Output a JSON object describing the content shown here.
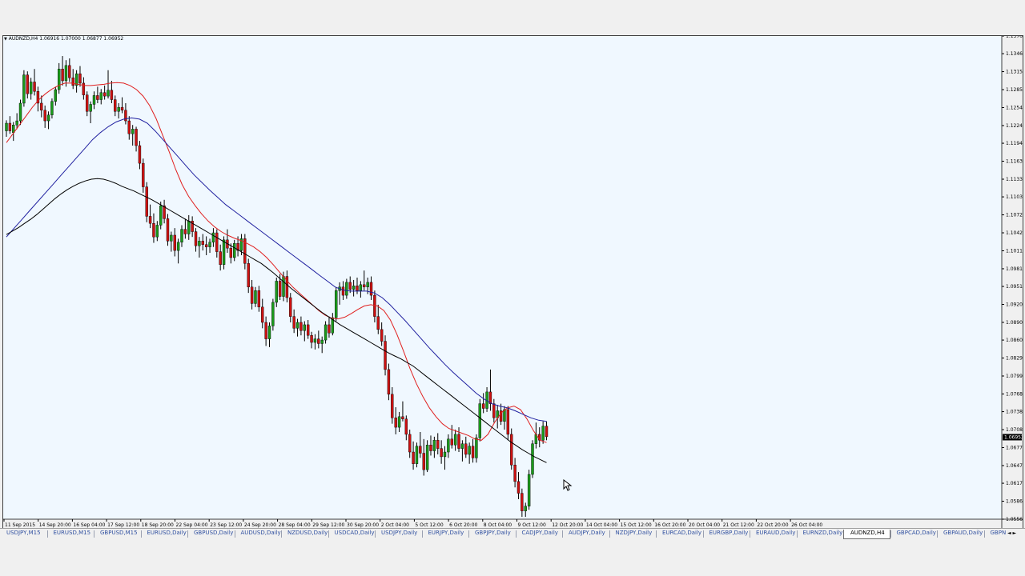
{
  "chart_header": {
    "symbol_line": "AUDNZD,H4  1.06916 1.07000 1.06877 1.06952"
  },
  "colors": {
    "background": "#f0f8ff",
    "bull": "#1a9a1a",
    "bear": "#cc1111",
    "ma_fast": "#e02020",
    "ma_mid": "#2020a0",
    "ma_slow": "#000000",
    "price_tag": "#000000"
  },
  "price_axis": {
    "labels": [
      "1.13760",
      "1.13460",
      "1.13155",
      "1.12850",
      "1.12545",
      "1.12240",
      "1.11940",
      "1.11635",
      "1.11330",
      "1.11030",
      "1.10725",
      "1.10420",
      "1.10115",
      "1.09810",
      "1.09510",
      "1.09205",
      "1.08900",
      "1.08600",
      "1.08295",
      "1.07990",
      "1.07685",
      "1.07385",
      "1.07080",
      "1.06775",
      "1.06470",
      "1.06170",
      "1.05865",
      "1.05560"
    ],
    "current_price": "1.06952"
  },
  "time_axis": {
    "labels": [
      "11 Sep 2015",
      "14 Sep 20:00",
      "16 Sep 04:00",
      "17 Sep 12:00",
      "18 Sep 20:00",
      "22 Sep 04:00",
      "23 Sep 12:00",
      "24 Sep 20:00",
      "28 Sep 04:00",
      "29 Sep 12:00",
      "30 Sep 20:00",
      "2 Oct 04:00",
      "5 Oct 12:00",
      "6 Oct 20:00",
      "8 Oct 04:00",
      "9 Oct 12:00",
      "12 Oct 20:00",
      "14 Oct 04:00",
      "15 Oct 12:00",
      "16 Oct 20:00",
      "20 Oct 04:00",
      "21 Oct 12:00",
      "22 Oct 20:00",
      "26 Oct 04:00"
    ]
  },
  "tabs": [
    {
      "label": "USDJPY,M15",
      "active": false
    },
    {
      "label": "EURUSD,M15",
      "active": false
    },
    {
      "label": "GBPUSD,M15",
      "active": false
    },
    {
      "label": "EURUSD,Daily",
      "active": false
    },
    {
      "label": "GBPUSD,Daily",
      "active": false
    },
    {
      "label": "AUDUSD,Daily",
      "active": false
    },
    {
      "label": "NZDUSD,Daily",
      "active": false
    },
    {
      "label": "USDCAD,Daily",
      "active": false
    },
    {
      "label": "USDJPY,Daily",
      "active": false
    },
    {
      "label": "EURJPY,Daily",
      "active": false
    },
    {
      "label": "GBPJPY,Daily",
      "active": false
    },
    {
      "label": "CADJPY,Daily",
      "active": false
    },
    {
      "label": "AUDJPY,Daily",
      "active": false
    },
    {
      "label": "NZDJPY,Daily",
      "active": false
    },
    {
      "label": "EURCAD,Daily",
      "active": false
    },
    {
      "label": "EURGBP,Daily",
      "active": false
    },
    {
      "label": "EURAUD,Daily",
      "active": false
    },
    {
      "label": "EURNZD,Daily",
      "active": false
    },
    {
      "label": "AUDNZD,H4",
      "active": true
    },
    {
      "label": "GBPCAD,Daily",
      "active": false
    },
    {
      "label": "GBPAUD,Daily",
      "active": false
    },
    {
      "label": "GBPN",
      "active": false
    }
  ],
  "tab_scroll": "◄ ►",
  "chart_data": {
    "type": "candlestick",
    "symbol": "AUDNZD",
    "timeframe": "H4",
    "ylim": [
      1.0556,
      1.1376
    ],
    "candles": [
      [
        1.1215,
        1.1233,
        1.1205,
        1.1228
      ],
      [
        1.1228,
        1.124,
        1.121,
        1.1215
      ],
      [
        1.1212,
        1.123,
        1.1198,
        1.1225
      ],
      [
        1.1225,
        1.1245,
        1.1218,
        1.1232
      ],
      [
        1.1232,
        1.1268,
        1.1225,
        1.1262
      ],
      [
        1.1262,
        1.1318,
        1.1256,
        1.131
      ],
      [
        1.131,
        1.1316,
        1.127,
        1.1278
      ],
      [
        1.1278,
        1.1305,
        1.1268,
        1.1298
      ],
      [
        1.1298,
        1.132,
        1.1275,
        1.1282
      ],
      [
        1.1282,
        1.129,
        1.1248,
        1.1262
      ],
      [
        1.1262,
        1.1275,
        1.1238,
        1.125
      ],
      [
        1.125,
        1.1258,
        1.122,
        1.1232
      ],
      [
        1.1232,
        1.1248,
        1.1218,
        1.1242
      ],
      [
        1.1242,
        1.127,
        1.1236,
        1.1265
      ],
      [
        1.1265,
        1.129,
        1.1258,
        1.1285
      ],
      [
        1.1285,
        1.133,
        1.1278,
        1.132
      ],
      [
        1.132,
        1.1342,
        1.1292,
        1.13
      ],
      [
        1.13,
        1.1335,
        1.129,
        1.1326
      ],
      [
        1.1326,
        1.1338,
        1.1298,
        1.1305
      ],
      [
        1.1305,
        1.132,
        1.1286,
        1.1292
      ],
      [
        1.1292,
        1.1318,
        1.128,
        1.1312
      ],
      [
        1.1312,
        1.1325,
        1.129,
        1.1296
      ],
      [
        1.1296,
        1.1306,
        1.1268,
        1.1276
      ],
      [
        1.1276,
        1.1282,
        1.124,
        1.1248
      ],
      [
        1.1248,
        1.1265,
        1.1228,
        1.126
      ],
      [
        1.126,
        1.1282,
        1.1252,
        1.1275
      ],
      [
        1.1275,
        1.129,
        1.1262,
        1.1268
      ],
      [
        1.1268,
        1.1286,
        1.126,
        1.128
      ],
      [
        1.128,
        1.1292,
        1.1268,
        1.1274
      ],
      [
        1.1274,
        1.1318,
        1.127,
        1.1284
      ],
      [
        1.1284,
        1.13,
        1.1262,
        1.1268
      ],
      [
        1.1268,
        1.1275,
        1.124,
        1.1248
      ],
      [
        1.1248,
        1.1262,
        1.1236,
        1.1255
      ],
      [
        1.1255,
        1.1272,
        1.1245,
        1.125
      ],
      [
        1.125,
        1.1262,
        1.1226,
        1.1232
      ],
      [
        1.1232,
        1.124,
        1.12,
        1.121
      ],
      [
        1.121,
        1.1225,
        1.119,
        1.1218
      ],
      [
        1.1218,
        1.1222,
        1.118,
        1.119
      ],
      [
        1.119,
        1.1198,
        1.115,
        1.116
      ],
      [
        1.116,
        1.1168,
        1.111,
        1.112
      ],
      [
        1.112,
        1.1128,
        1.106,
        1.107
      ],
      [
        1.107,
        1.109,
        1.105,
        1.1058
      ],
      [
        1.1058,
        1.1075,
        1.1025,
        1.1035
      ],
      [
        1.1035,
        1.1062,
        1.1028,
        1.1055
      ],
      [
        1.1055,
        1.1095,
        1.1048,
        1.1088
      ],
      [
        1.1088,
        1.1098,
        1.1058,
        1.1066
      ],
      [
        1.1066,
        1.1074,
        1.102,
        1.1028
      ],
      [
        1.1028,
        1.1044,
        1.101,
        1.1038
      ],
      [
        1.1038,
        1.105,
        1.1002,
        1.1012
      ],
      [
        1.1012,
        1.1032,
        1.099,
        1.1026
      ],
      [
        1.1026,
        1.1055,
        1.1018,
        1.1048
      ],
      [
        1.1048,
        1.1066,
        1.1032,
        1.104
      ],
      [
        1.104,
        1.1072,
        1.103,
        1.1062
      ],
      [
        1.1062,
        1.107,
        1.1035,
        1.1044
      ],
      [
        1.1044,
        1.105,
        1.101,
        1.102
      ],
      [
        1.102,
        1.1035,
        1.1,
        1.1028
      ],
      [
        1.1028,
        1.104,
        1.1012,
        1.1022
      ],
      [
        1.1022,
        1.1036,
        1.1004,
        1.1018
      ],
      [
        1.1018,
        1.1032,
        1.1008,
        1.1026
      ],
      [
        1.1026,
        1.105,
        1.1018,
        1.1042
      ],
      [
        1.1042,
        1.1048,
        1.1,
        1.101
      ],
      [
        1.101,
        1.1022,
        1.0978,
        1.0988
      ],
      [
        1.0988,
        1.1036,
        1.098,
        1.103
      ],
      [
        1.103,
        1.1048,
        1.1008,
        1.1016
      ],
      [
        1.1016,
        1.1024,
        1.099,
        1.1
      ],
      [
        1.1,
        1.103,
        1.0994,
        1.1024
      ],
      [
        1.1024,
        1.1036,
        1.1002,
        1.1012
      ],
      [
        1.1012,
        1.104,
        1.1004,
        1.1032
      ],
      [
        1.1032,
        1.104,
        1.098,
        1.099
      ],
      [
        1.099,
        1.0998,
        1.094,
        1.095
      ],
      [
        1.095,
        1.0962,
        1.0912,
        1.0922
      ],
      [
        1.0922,
        1.095,
        1.0916,
        1.0944
      ],
      [
        1.0944,
        1.0952,
        1.0908,
        1.0916
      ],
      [
        1.0916,
        1.093,
        1.088,
        1.089
      ],
      [
        1.089,
        1.09,
        1.085,
        1.0862
      ],
      [
        1.0862,
        1.089,
        1.0848,
        1.0884
      ],
      [
        1.0884,
        1.093,
        1.0876,
        1.0924
      ],
      [
        1.0924,
        1.0966,
        1.0916,
        1.096
      ],
      [
        1.096,
        1.0972,
        1.0928,
        1.0934
      ],
      [
        1.0934,
        1.0976,
        1.0926,
        1.0968
      ],
      [
        1.0968,
        1.0978,
        1.0924,
        1.0932
      ],
      [
        1.0932,
        1.094,
        1.089,
        1.09
      ],
      [
        1.09,
        1.0912,
        1.0872,
        1.088
      ],
      [
        1.088,
        1.0896,
        1.0866,
        1.089
      ],
      [
        1.089,
        1.09,
        1.0868,
        1.0876
      ],
      [
        1.0876,
        1.0892,
        1.0858,
        1.0886
      ],
      [
        1.0886,
        1.0894,
        1.0862,
        1.0868
      ],
      [
        1.0868,
        1.0874,
        1.0846,
        1.0856
      ],
      [
        1.0856,
        1.087,
        1.0844,
        1.0862
      ],
      [
        1.0862,
        1.0876,
        1.0846,
        1.0854
      ],
      [
        1.0854,
        1.0866,
        1.0838,
        1.086
      ],
      [
        1.086,
        1.0892,
        1.0854,
        1.0886
      ],
      [
        1.0886,
        1.09,
        1.0864,
        1.0872
      ],
      [
        1.0872,
        1.0906,
        1.0868,
        1.0898
      ],
      [
        1.0898,
        1.095,
        1.0892,
        1.0944
      ],
      [
        1.0944,
        1.0958,
        1.092,
        1.095
      ],
      [
        1.095,
        1.096,
        1.0928,
        1.0936
      ],
      [
        1.0936,
        1.0964,
        1.093,
        1.0958
      ],
      [
        1.0958,
        1.0968,
        1.094,
        1.0946
      ],
      [
        1.0946,
        1.0962,
        1.0934,
        1.0952
      ],
      [
        1.0952,
        1.0966,
        1.0938,
        1.0944
      ],
      [
        1.0944,
        1.096,
        1.0932,
        1.0954
      ],
      [
        1.0954,
        1.0978,
        1.0944,
        1.095
      ],
      [
        1.095,
        1.0966,
        1.0938,
        1.0958
      ],
      [
        1.0958,
        1.0968,
        1.0928,
        1.0936
      ],
      [
        1.0936,
        1.0944,
        1.089,
        1.09
      ],
      [
        1.09,
        1.092,
        1.087,
        1.0878
      ],
      [
        1.0878,
        1.089,
        1.085,
        1.0858
      ],
      [
        1.0858,
        1.0868,
        1.08,
        1.081
      ],
      [
        1.081,
        1.082,
        1.0758,
        1.0768
      ],
      [
        1.0768,
        1.078,
        1.0718,
        1.0728
      ],
      [
        1.0728,
        1.0746,
        1.07,
        1.0712
      ],
      [
        1.0712,
        1.0738,
        1.0704,
        1.073
      ],
      [
        1.073,
        1.0756,
        1.0722,
        1.0726
      ],
      [
        1.0726,
        1.0732,
        1.069,
        1.07
      ],
      [
        1.07,
        1.0708,
        1.066,
        1.067
      ],
      [
        1.067,
        1.0688,
        1.064,
        1.065
      ],
      [
        1.065,
        1.0686,
        1.0644,
        1.068
      ],
      [
        1.068,
        1.0704,
        1.066,
        1.0668
      ],
      [
        1.0668,
        1.0692,
        1.063,
        1.064
      ],
      [
        1.064,
        1.069,
        1.0636,
        1.0682
      ],
      [
        1.0682,
        1.0698,
        1.0664,
        1.0672
      ],
      [
        1.0672,
        1.0696,
        1.066,
        1.069
      ],
      [
        1.069,
        1.0702,
        1.0666,
        1.0676
      ],
      [
        1.0676,
        1.069,
        1.065,
        1.0662
      ],
      [
        1.0662,
        1.068,
        1.064,
        1.067
      ],
      [
        1.067,
        1.07,
        1.066,
        1.0692
      ],
      [
        1.0692,
        1.0716,
        1.0676,
        1.0682
      ],
      [
        1.0682,
        1.0708,
        1.0672,
        1.07
      ],
      [
        1.07,
        1.0712,
        1.067,
        1.0676
      ],
      [
        1.0676,
        1.069,
        1.0654,
        1.0684
      ],
      [
        1.0684,
        1.0696,
        1.066,
        1.0666
      ],
      [
        1.0666,
        1.0686,
        1.065,
        1.068
      ],
      [
        1.068,
        1.0692,
        1.0652,
        1.066
      ],
      [
        1.066,
        1.07,
        1.0652,
        1.0694
      ],
      [
        1.0694,
        1.076,
        1.0688,
        1.0752
      ],
      [
        1.0752,
        1.077,
        1.0736,
        1.0744
      ],
      [
        1.0744,
        1.078,
        1.0738,
        1.0772
      ],
      [
        1.0772,
        1.081,
        1.074,
        1.0752
      ],
      [
        1.0752,
        1.076,
        1.072,
        1.0728
      ],
      [
        1.0728,
        1.075,
        1.071,
        1.074
      ],
      [
        1.074,
        1.0752,
        1.0716,
        1.0722
      ],
      [
        1.0722,
        1.0748,
        1.0708,
        1.0742
      ],
      [
        1.0742,
        1.0748,
        1.069,
        1.07
      ],
      [
        1.07,
        1.071,
        1.064,
        1.0648
      ],
      [
        1.0648,
        1.066,
        1.061,
        1.062
      ],
      [
        1.062,
        1.0636,
        1.059,
        1.06
      ],
      [
        1.06,
        1.0608,
        1.056,
        1.057
      ],
      [
        1.057,
        1.0584,
        1.056,
        1.0578
      ],
      [
        1.0578,
        1.064,
        1.0572,
        1.0632
      ],
      [
        1.0632,
        1.069,
        1.0626,
        1.0684
      ],
      [
        1.0684,
        1.072,
        1.0676,
        1.07
      ],
      [
        1.07,
        1.0712,
        1.0678,
        1.069
      ],
      [
        1.069,
        1.0722,
        1.0684,
        1.0714
      ],
      [
        1.0714,
        1.0722,
        1.069,
        1.0696
      ]
    ],
    "moving_averages": [
      {
        "name": "fast",
        "color": "#e02020",
        "values": [
          1.1195,
          1.121,
          1.1225,
          1.124,
          1.1255,
          1.1268,
          1.1278,
          1.1286,
          1.1292,
          1.1296,
          1.1296,
          1.1294,
          1.1292,
          1.1292,
          1.1293,
          1.1294,
          1.1296,
          1.1297,
          1.1296,
          1.1292,
          1.1285,
          1.1274,
          1.1258,
          1.1236,
          1.1208,
          1.118,
          1.115,
          1.1124,
          1.1104,
          1.1088,
          1.1074,
          1.1062,
          1.1052,
          1.1044,
          1.1038,
          1.1033,
          1.1029,
          1.1024,
          1.1018,
          1.101,
          1.1,
          1.0988,
          1.0975,
          1.0962,
          1.095,
          1.094,
          1.093,
          1.092,
          1.091,
          1.0902,
          1.0897,
          1.0896,
          1.0899,
          1.0905,
          1.0912,
          1.0918,
          1.092,
          1.0918,
          1.091,
          1.0894,
          1.087,
          1.0842,
          1.0812,
          1.0786,
          1.0764,
          1.0745,
          1.073,
          1.0718,
          1.071,
          1.0706,
          1.0702,
          1.0698,
          1.0692,
          1.069,
          1.07,
          1.072,
          1.0736,
          1.0745,
          1.0748,
          1.0742,
          1.0726,
          1.0706,
          1.069,
          1.0686
        ]
      },
      {
        "name": "mid",
        "color": "#2020a0",
        "values": [
          1.1035,
          1.105,
          1.1065,
          1.108,
          1.1095,
          1.111,
          1.1125,
          1.114,
          1.1155,
          1.117,
          1.1185,
          1.12,
          1.1212,
          1.1222,
          1.123,
          1.1235,
          1.1237,
          1.1235,
          1.1228,
          1.1215,
          1.12,
          1.1185,
          1.117,
          1.1155,
          1.114,
          1.1127,
          1.1114,
          1.1102,
          1.109,
          1.108,
          1.107,
          1.106,
          1.105,
          1.104,
          1.103,
          1.102,
          1.101,
          1.1,
          1.099,
          1.098,
          1.097,
          1.096,
          1.095,
          1.0945,
          1.0943,
          1.0943,
          1.0943,
          1.094,
          1.0932,
          1.092,
          1.0906,
          1.0892,
          1.0877,
          1.0862,
          1.0847,
          1.0833,
          1.0819,
          1.0806,
          1.0794,
          1.0782,
          1.077,
          1.076,
          1.0752,
          1.0748,
          1.0745,
          1.074,
          1.0734,
          1.0728,
          1.0724,
          1.0722
        ]
      },
      {
        "name": "slow",
        "color": "#000000",
        "values": [
          1.1039,
          1.1045,
          1.1051,
          1.1058,
          1.1065,
          1.1073,
          1.1082,
          1.1091,
          1.11,
          1.1108,
          1.1115,
          1.1121,
          1.1126,
          1.113,
          1.1133,
          1.1134,
          1.1133,
          1.113,
          1.1126,
          1.1121,
          1.1117,
          1.1113,
          1.1108,
          1.1103,
          1.1098,
          1.1092,
          1.1086,
          1.108,
          1.1074,
          1.1068,
          1.1062,
          1.1056,
          1.105,
          1.1044,
          1.1038,
          1.1032,
          1.1026,
          1.102,
          1.1014,
          1.1008,
          1.1002,
          1.0996,
          1.099,
          1.0982,
          1.0974,
          1.0965,
          1.0956,
          1.0947,
          1.0939,
          1.0931,
          1.0923,
          1.0915,
          1.0907,
          1.09,
          1.0893,
          1.0886,
          1.088,
          1.0874,
          1.0868,
          1.0862,
          1.0856,
          1.085,
          1.0844,
          1.0838,
          1.0833,
          1.0828,
          1.0822,
          1.0816,
          1.0808,
          1.08,
          1.0792,
          1.0784,
          1.0776,
          1.0768,
          1.076,
          1.0752,
          1.0744,
          1.0736,
          1.0728,
          1.072,
          1.0712,
          1.0704,
          1.0696,
          1.0688,
          1.0681,
          1.0674,
          1.0668,
          1.0662,
          1.0657,
          1.0652
        ]
      }
    ]
  }
}
